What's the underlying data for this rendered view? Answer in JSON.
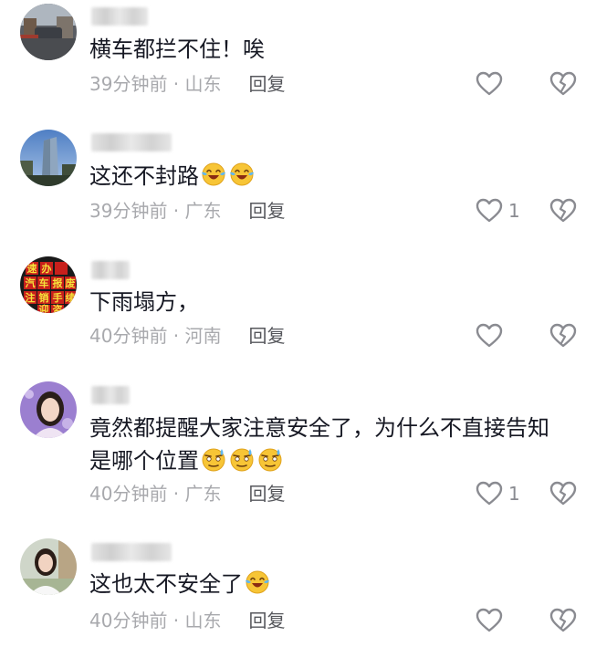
{
  "colors": {
    "text": "#161823",
    "meta": "#a8a9ad",
    "reply": "#56575c",
    "icon": "#8a8b91"
  },
  "comments": [
    {
      "username": "",
      "avatar": "street-photo-avatar",
      "text": "横车都拦不住！唉",
      "emojis": [],
      "time": "39分钟前",
      "location": "山东",
      "reply_label": "回复",
      "likes": ""
    },
    {
      "username": "",
      "avatar": "building-photo-avatar",
      "text": "这还不封路",
      "emojis": [
        "laughing-crying-emoji",
        "laughing-crying-emoji"
      ],
      "time": "39分钟前",
      "location": "广东",
      "reply_label": "回复",
      "likes": "1"
    },
    {
      "username": "",
      "avatar": "sign-grid-avatar",
      "avatar_chars": [
        "速",
        "办",
        "汽",
        "车",
        "报",
        "废",
        "注",
        "销",
        "手",
        "续",
        "迎",
        "咨"
      ],
      "text": "下雨塌方，",
      "emojis": [],
      "time": "40分钟前",
      "location": "河南",
      "reply_label": "回复",
      "likes": ""
    },
    {
      "username": "",
      "avatar": "woman-purple-avatar",
      "text": "竟然都提醒大家注意安全了，为什么不直接告知是哪个位置",
      "emojis": [
        "sweat-emoji",
        "sweat-emoji",
        "sweat-emoji"
      ],
      "time": "40分钟前",
      "location": "广东",
      "reply_label": "回复",
      "likes": "1"
    },
    {
      "username": "",
      "avatar": "woman-outdoor-avatar",
      "text": "这也太不安全了",
      "emojis": [
        "laughing-crying-emoji"
      ],
      "time": "40分钟前",
      "location": "山东",
      "reply_label": "回复",
      "likes": ""
    }
  ]
}
